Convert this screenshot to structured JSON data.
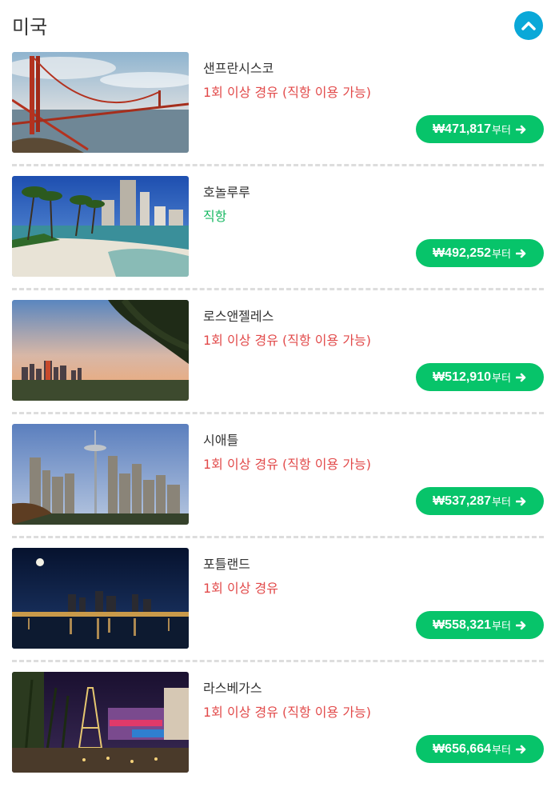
{
  "section": {
    "title": "미국",
    "collapse_icon": "chevron-up-icon",
    "accent_color": "#0aa8d8"
  },
  "colors": {
    "route_connecting": "#e24a4a",
    "route_direct": "#17b862",
    "price_button": "#07c46a"
  },
  "destinations": [
    {
      "name": "샌프란시스코",
      "route": "1회 이상 경유 (직항 이용 가능)",
      "route_type": "connecting",
      "price": "₩471,817",
      "price_suffix": "부터"
    },
    {
      "name": "호놀루루",
      "route": "직항",
      "route_type": "direct",
      "price": "₩492,252",
      "price_suffix": "부터"
    },
    {
      "name": "로스앤젤레스",
      "route": "1회 이상 경유 (직항 이용 가능)",
      "route_type": "connecting",
      "price": "₩512,910",
      "price_suffix": "부터"
    },
    {
      "name": "시애틀",
      "route": "1회 이상 경유 (직항 이용 가능)",
      "route_type": "connecting",
      "price": "₩537,287",
      "price_suffix": "부터"
    },
    {
      "name": "포틀랜드",
      "route": "1회 이상 경유",
      "route_type": "connecting",
      "price": "₩558,321",
      "price_suffix": "부터"
    },
    {
      "name": "라스베가스",
      "route": "1회 이상 경유 (직항 이용 가능)",
      "route_type": "connecting",
      "price": "₩656,664",
      "price_suffix": "부터"
    }
  ]
}
